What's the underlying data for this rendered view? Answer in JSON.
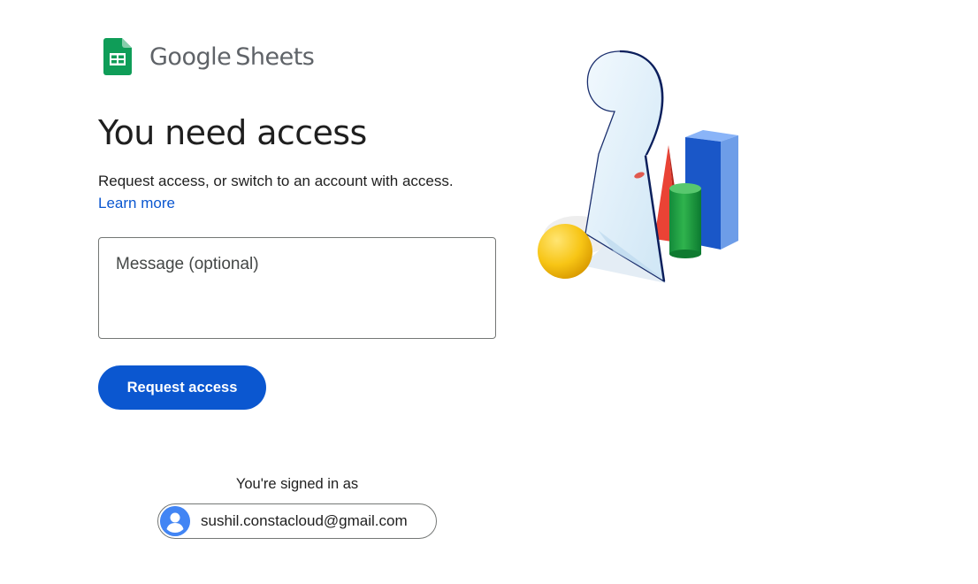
{
  "logo": {
    "brand": "Google",
    "product": "Sheets",
    "icon": "google-sheets-icon"
  },
  "heading": "You need access",
  "subtitle": "Request access, or switch to an account with access.",
  "learn_more": "Learn more",
  "message": {
    "placeholder": "Message (optional)",
    "value": ""
  },
  "request_button": "Request access",
  "signed_in": {
    "label": "You're signed in as",
    "email": "sushil.constacloud@gmail.com",
    "avatar_icon": "account-avatar-icon"
  },
  "colors": {
    "primary": "#0b57d0",
    "sheets_green": "#0f9d58",
    "text": "#1f1f1f",
    "border": "#747775"
  }
}
